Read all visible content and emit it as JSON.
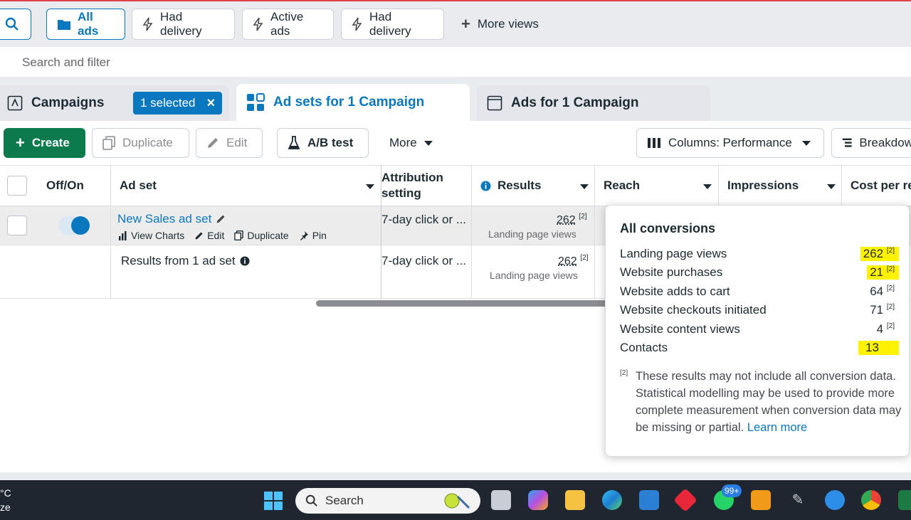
{
  "views_bar": {
    "tabs": [
      {
        "label": "All ads",
        "icon": "folder-icon",
        "active": true
      },
      {
        "label": "Had delivery",
        "icon": "bolt-icon"
      },
      {
        "label": "Active ads",
        "icon": "bolt-icon"
      },
      {
        "label": "Had delivery",
        "icon": "bolt-icon"
      }
    ],
    "more_views": "More views"
  },
  "search_filter": {
    "placeholder": "Search and filter"
  },
  "level_tabs": {
    "campaigns": "Campaigns",
    "selected_badge": "1 selected",
    "adsets": "Ad sets for 1 Campaign",
    "ads": "Ads for 1 Campaign"
  },
  "toolbar": {
    "create": "Create",
    "duplicate": "Duplicate",
    "edit": "Edit",
    "ab_test": "A/B test",
    "more": "More",
    "columns": "Columns: Performance",
    "breakdown": "Breakdow"
  },
  "table": {
    "headers": {
      "offon": "Off/On",
      "adset": "Ad set",
      "attribution_line1": "Attribution",
      "attribution_line2": "setting",
      "results": "Results",
      "reach": "Reach",
      "impressions": "Impressions",
      "cost": "Cost per re"
    },
    "row1": {
      "name": "New Sales ad set",
      "actions": [
        "View Charts",
        "Edit",
        "Duplicate",
        "Pin"
      ],
      "attribution": "7-day click or ...",
      "results": "262",
      "results_sup": "[2]",
      "results_sub": "Landing page views"
    },
    "summary": {
      "label": "Results from 1 ad set",
      "attribution": "7-day click or ...",
      "results": "262",
      "results_sup": "[2]",
      "results_sub": "Landing page views"
    }
  },
  "tooltip": {
    "title": "All conversions",
    "rows": [
      {
        "label": "Landing page views",
        "value": "262",
        "sup": "[2]",
        "highlight": true
      },
      {
        "label": "Website purchases",
        "value": "21",
        "sup": "[2]",
        "highlight": true
      },
      {
        "label": "Website adds to cart",
        "value": "64",
        "sup": "[2]",
        "highlight": false
      },
      {
        "label": "Website checkouts initiated",
        "value": "71",
        "sup": "[2]",
        "highlight": false
      },
      {
        "label": "Website content views",
        "value": "4",
        "sup": "[2]",
        "highlight": false
      },
      {
        "label": "Contacts",
        "value": "13",
        "sup": "",
        "highlight": true
      }
    ],
    "footnote_marker": "[2]",
    "footnote": "These results may not include all conversion data. Statistical modelling may be used to provide more complete measurement when conversion data may be missing or partial.",
    "learn_more": "Learn more"
  },
  "taskbar": {
    "left_line1": "°C",
    "left_line2": "ze",
    "search": "Search",
    "notification_badge": "99+"
  },
  "colors": {
    "accent": "#0a78be",
    "create": "#0d7a4e",
    "highlight": "#fff200"
  }
}
